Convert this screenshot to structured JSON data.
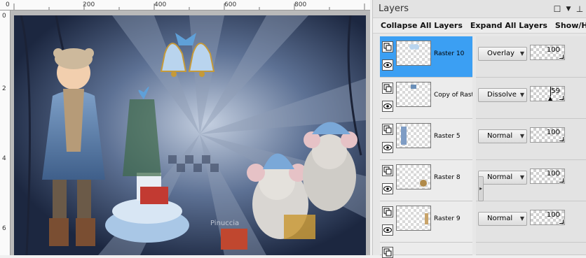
{
  "ruler": {
    "top_labels": [
      "0",
      "200",
      "400",
      "600",
      "800"
    ],
    "left_labels": [
      "0",
      "2",
      "4",
      "6"
    ]
  },
  "canvas": {
    "watermark": "Pinuccia"
  },
  "layers_panel": {
    "title": "Layers",
    "toolbar": {
      "collapse_label": "Collapse All Layers",
      "expand_label": "Expand All Layers",
      "show_hide_label": "Show/Hide Quick"
    },
    "layers": [
      {
        "name": "Raster 10",
        "blend_mode": "Overlay",
        "opacity": "100",
        "selected": true
      },
      {
        "name": "Copy of Raste",
        "blend_mode": "Dissolve",
        "opacity": "59",
        "selected": false
      },
      {
        "name": "Raster 5",
        "blend_mode": "Normal",
        "opacity": "100",
        "selected": false
      },
      {
        "name": "Raster 8",
        "blend_mode": "Normal",
        "opacity": "100",
        "selected": false
      },
      {
        "name": "Raster 9",
        "blend_mode": "Normal",
        "opacity": "100",
        "selected": false
      }
    ]
  },
  "colors": {
    "selected_row": "#3b9ff3",
    "panel_bg": "#e7e7e7"
  }
}
